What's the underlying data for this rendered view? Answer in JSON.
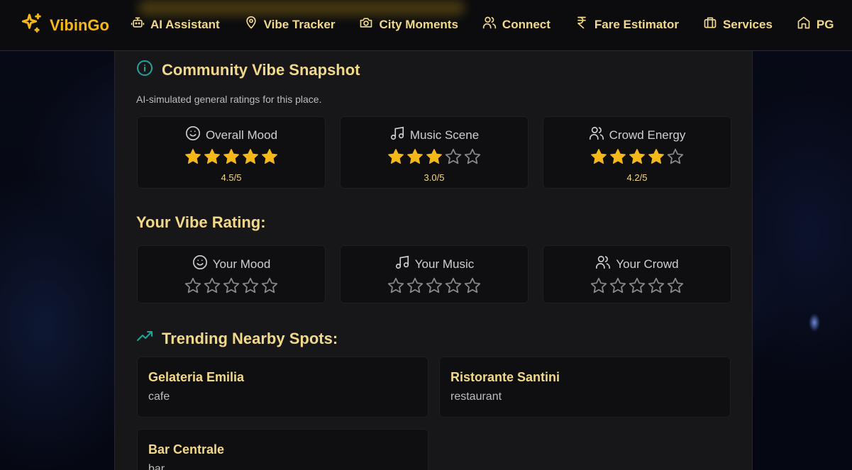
{
  "brand": {
    "name": "VibinGo",
    "accent": "#f5b819",
    "icon": "sparkles-icon"
  },
  "nav": {
    "items": [
      {
        "label": "AI Assistant",
        "icon": "bot-icon"
      },
      {
        "label": "Vibe Tracker",
        "icon": "map-pin-icon"
      },
      {
        "label": "City Moments",
        "icon": "camera-icon"
      },
      {
        "label": "Connect",
        "icon": "users-icon"
      },
      {
        "label": "Fare Estimator",
        "icon": "rupee-icon"
      },
      {
        "label": "Services",
        "icon": "briefcase-icon"
      },
      {
        "label": "PG",
        "icon": "home-icon"
      }
    ]
  },
  "snapshot": {
    "title": "Community Vibe Snapshot",
    "subtitle": "AI-simulated general ratings for this place.",
    "ratings": [
      {
        "label": "Overall Mood",
        "icon": "smile-icon",
        "stars_filled": 5,
        "score": "4.5/5"
      },
      {
        "label": "Music Scene",
        "icon": "music-icon",
        "stars_filled": 3,
        "score": "3.0/5"
      },
      {
        "label": "Crowd Energy",
        "icon": "users-icon",
        "stars_filled": 4,
        "score": "4.2/5"
      }
    ]
  },
  "your_rating": {
    "title": "Your Vibe Rating:",
    "items": [
      {
        "label": "Your Mood",
        "icon": "smile-icon"
      },
      {
        "label": "Your Music",
        "icon": "music-icon"
      },
      {
        "label": "Your Crowd",
        "icon": "users-icon"
      }
    ]
  },
  "trending": {
    "title": "Trending Nearby Spots:",
    "icon": "trending-up-icon",
    "spots": [
      {
        "name": "Gelateria Emilia",
        "type": "cafe"
      },
      {
        "name": "Ristorante Santini",
        "type": "restaurant"
      },
      {
        "name": "Bar Centrale",
        "type": "bar"
      }
    ]
  },
  "colors": {
    "star_filled": "#f5b819",
    "star_empty": "#8a8a8a",
    "heading": "#f2d98a",
    "info_icon": "#1fa39a"
  }
}
